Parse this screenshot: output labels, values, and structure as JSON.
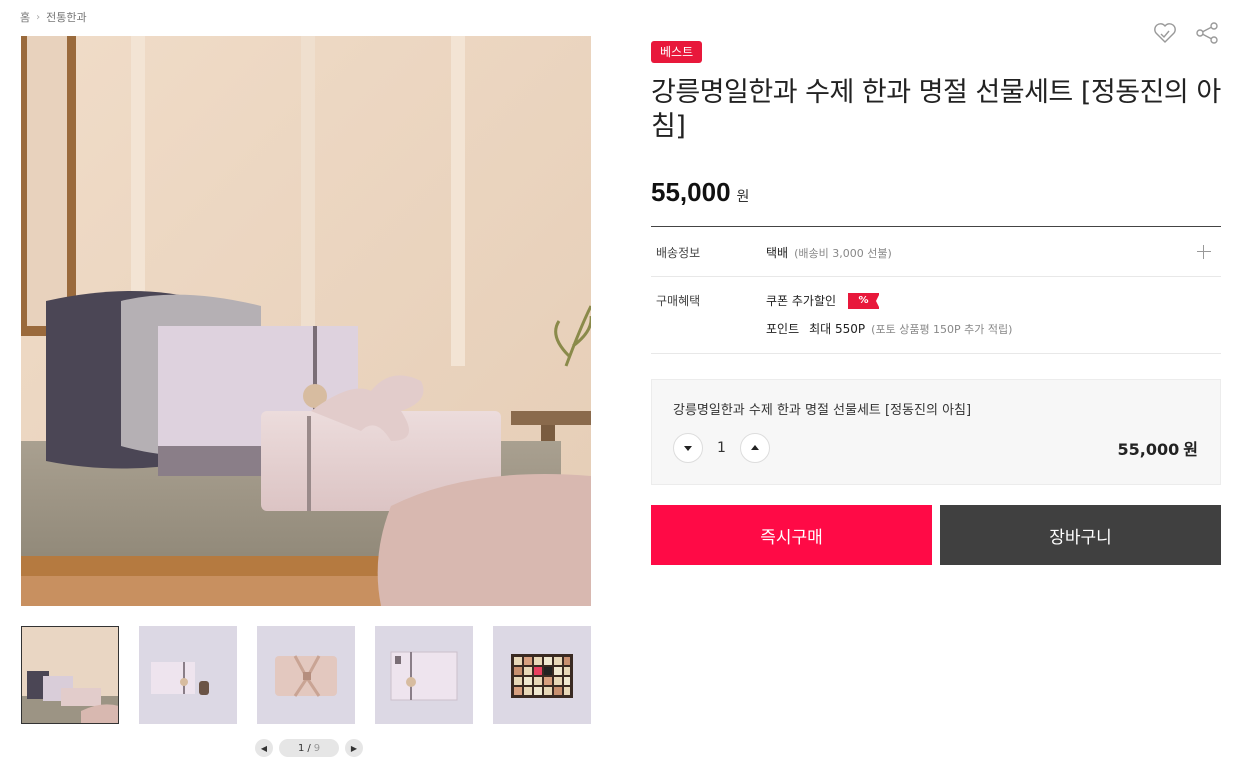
{
  "breadcrumb": {
    "home": "홈",
    "category": "전통한과"
  },
  "gallery": {
    "current_page": "1",
    "separator": "/",
    "total_pages": "9"
  },
  "product": {
    "badge": "베스트",
    "title": "강릉명일한과 수제 한과 명절 선물세트 [정동진의 아침]",
    "price": "55,000",
    "currency": "원"
  },
  "info": {
    "shipping_label": "배송정보",
    "shipping_value": "택배",
    "shipping_note": "(배송비 3,000 선불)",
    "benefit_label": "구매혜택",
    "coupon_text": "쿠폰 추가할인",
    "coupon_badge": "%",
    "point_label": "포인트",
    "point_value": "최대 550P",
    "point_note": "(포토 상품평 150P 추가 적립)"
  },
  "option": {
    "name": "강릉명일한과 수제 한과 명절 선물세트 [정동진의 아침]",
    "quantity": "1",
    "price": "55,000",
    "currency": "원"
  },
  "actions": {
    "buy": "즉시구매",
    "cart": "장바구니"
  },
  "colors": {
    "accent": "#ff0a46",
    "badge": "#e8183b",
    "cart": "#404040"
  }
}
